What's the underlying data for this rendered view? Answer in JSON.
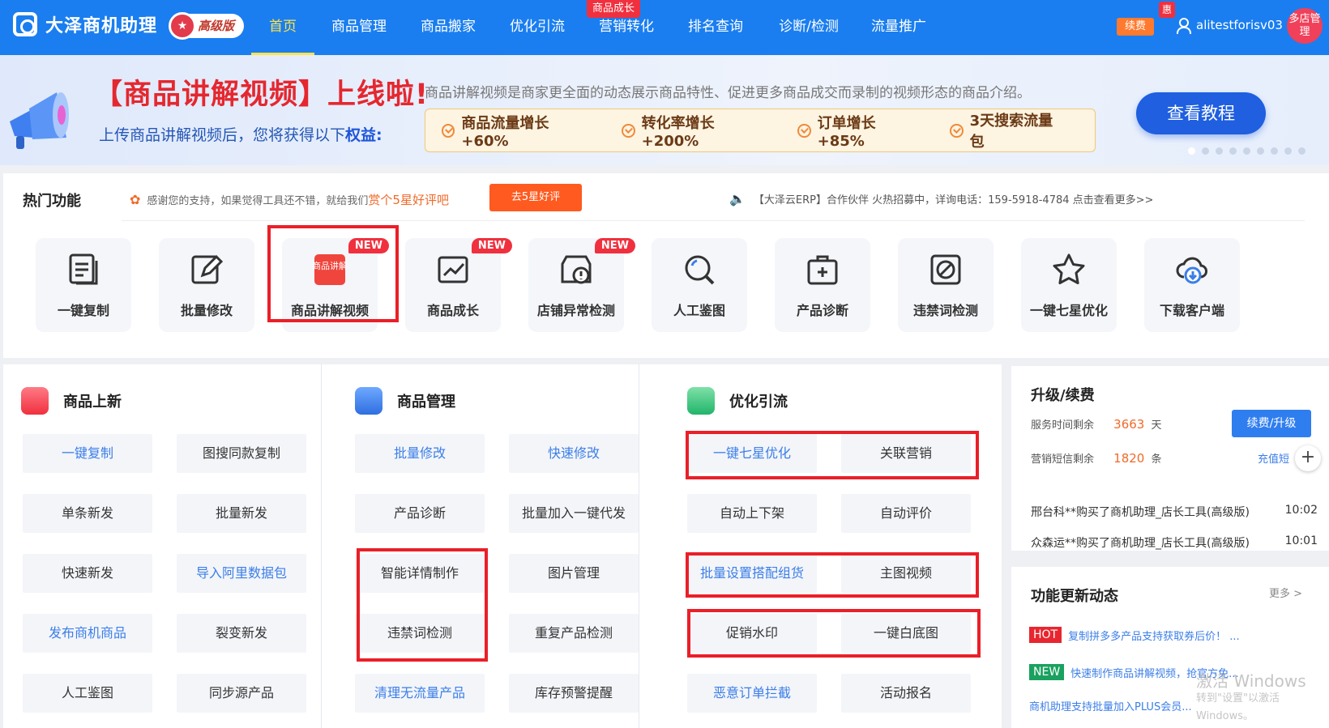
{
  "header": {
    "app_name": "大泽商机助理",
    "edition": "高级版",
    "nav": [
      {
        "label": "首页",
        "active": true
      },
      {
        "label": "商品管理"
      },
      {
        "label": "商品搬家"
      },
      {
        "label": "优化引流"
      },
      {
        "label": "营销转化"
      },
      {
        "label": "排名查询"
      },
      {
        "label": "诊断/检测"
      },
      {
        "label": "流量推广"
      }
    ],
    "nav_tag": "商品成长",
    "renew_label": "续费",
    "hui_label": "惠",
    "username": "alitestforisv03",
    "shop_mgr": "多店管理"
  },
  "banner": {
    "title": "【商品讲解视频】上线啦!",
    "description": "商品讲解视频是商家更全面的动态展示商品特性、促进更多商品成交而录制的视频形态的商品介绍。",
    "subtitle_prefix": "上传商品讲解视频后，您将获得以下",
    "subtitle_bold": "权益:",
    "benefits": [
      "商品流量增长+60%",
      "转化率增长+200%",
      "订单增长+85%",
      "3天搜索流量包"
    ],
    "tutorial_button": "查看教程",
    "slides": 9,
    "active_slide": 1
  },
  "hot": {
    "title": "热门功能",
    "thanks_text": "感谢您的支持，如果觉得工具还不错，就给我们",
    "thanks_highlight": "赏个5星好评吧",
    "rate_button": "去5星好评",
    "notice": "【大泽云ERP】合作伙伴 火热招募中，详询电话：159-5918-4784 点击查看更多>>",
    "new_tag": "NEW",
    "tiles": [
      {
        "label": "一键复制",
        "icon": "copy-doc-icon"
      },
      {
        "label": "批量修改",
        "icon": "edit-pencil-icon"
      },
      {
        "label": "商品讲解视频",
        "icon": "video-explain-icon",
        "icon_text": "商品讲解",
        "new": true
      },
      {
        "label": "商品成长",
        "icon": "growth-chart-icon",
        "new": true
      },
      {
        "label": "店铺异常检测",
        "icon": "shop-alert-icon",
        "new": true
      },
      {
        "label": "人工鉴图",
        "icon": "magnifier-icon"
      },
      {
        "label": "产品诊断",
        "icon": "medkit-icon"
      },
      {
        "label": "违禁词检测",
        "icon": "forbidden-icon"
      },
      {
        "label": "一键七星优化",
        "icon": "star-icon"
      },
      {
        "label": "下载客户端",
        "icon": "cloud-download-icon"
      }
    ]
  },
  "columns": [
    {
      "title": "商品上新",
      "icon": "box-icon",
      "buttons": [
        "一键复制",
        "图搜同款复制",
        "单条新发",
        "批量新发",
        "快速新发",
        "导入阿里数据包",
        "发布商机商品",
        "裂变新发",
        "人工鉴图",
        "同步源产品"
      ]
    },
    {
      "title": "商品管理",
      "icon": "bag-icon",
      "buttons": [
        "批量修改",
        "快速修改",
        "产品诊断",
        "批量加入一键代发",
        "智能详情制作",
        "图片管理",
        "违禁词检测",
        "重复产品检测",
        "清理无流量产品",
        "库存预警提醒"
      ]
    },
    {
      "title": "优化引流",
      "icon": "chart-icon",
      "buttons": [
        "一键七星优化",
        "关联营销",
        "自动上下架",
        "自动评价",
        "批量设置搭配组货",
        "主图视频",
        "促销水印",
        "一键白底图",
        "恶意订单拦截",
        "活动报名"
      ]
    }
  ],
  "account": {
    "title": "升级/续费",
    "service_label": "服务时间剩余",
    "service_value": "3663",
    "service_unit": "天",
    "sms_label": "营销短信剩余",
    "sms_value": "1820",
    "sms_unit": "条",
    "upgrade_button": "续费/升级",
    "recharge_link": "充值短",
    "feed": [
      {
        "text": "邢台科**购买了商机助理_店长工具(高级版)",
        "time": "10:02"
      },
      {
        "text": "众森运**购买了商机助理_店长工具(高级版)",
        "time": "10:01"
      }
    ]
  },
  "updates": {
    "title": "功能更新动态",
    "more": "更多 >",
    "items": [
      {
        "tag": "HOT",
        "tag_color": "#e8262f",
        "text": "复制拼多多产品支持获取券后价！ ..."
      },
      {
        "tag": "NEW",
        "tag_color": "#1aa15f",
        "text": "快速制作商品讲解视频，抢官方免..."
      },
      {
        "tag": "",
        "text": "商机助理支持批量加入PLUS会员..."
      }
    ]
  },
  "watermark": {
    "line1": "激活 Windows",
    "line2": "转到\"设置\"以激活 Windows。"
  },
  "colors": {
    "primary": "#1a7ef0",
    "accent": "#ff5a1f",
    "highlight_box": "#ea1f28"
  }
}
